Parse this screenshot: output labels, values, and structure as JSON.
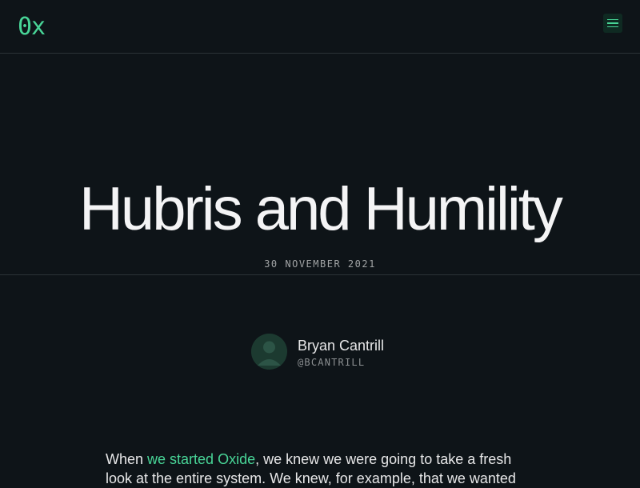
{
  "header": {
    "logo": "0x",
    "menu_icon": "hamburger-menu-icon"
  },
  "post": {
    "title": "Hubris and Humility",
    "date": "30 NOVEMBER 2021"
  },
  "author": {
    "name": "Bryan Cantrill",
    "handle": "@BCANTRILL"
  },
  "body": {
    "intro_prefix": "When ",
    "intro_link": "we started Oxide",
    "intro_suffix": ", we knew we were going to take a fresh look at the entire system. We knew, for example, that we wanted"
  },
  "colors": {
    "background": "#0e1418",
    "accent": "#48d597",
    "text": "#e7e7e8",
    "muted": "#a1a4a5",
    "divider": "#2b3236"
  }
}
